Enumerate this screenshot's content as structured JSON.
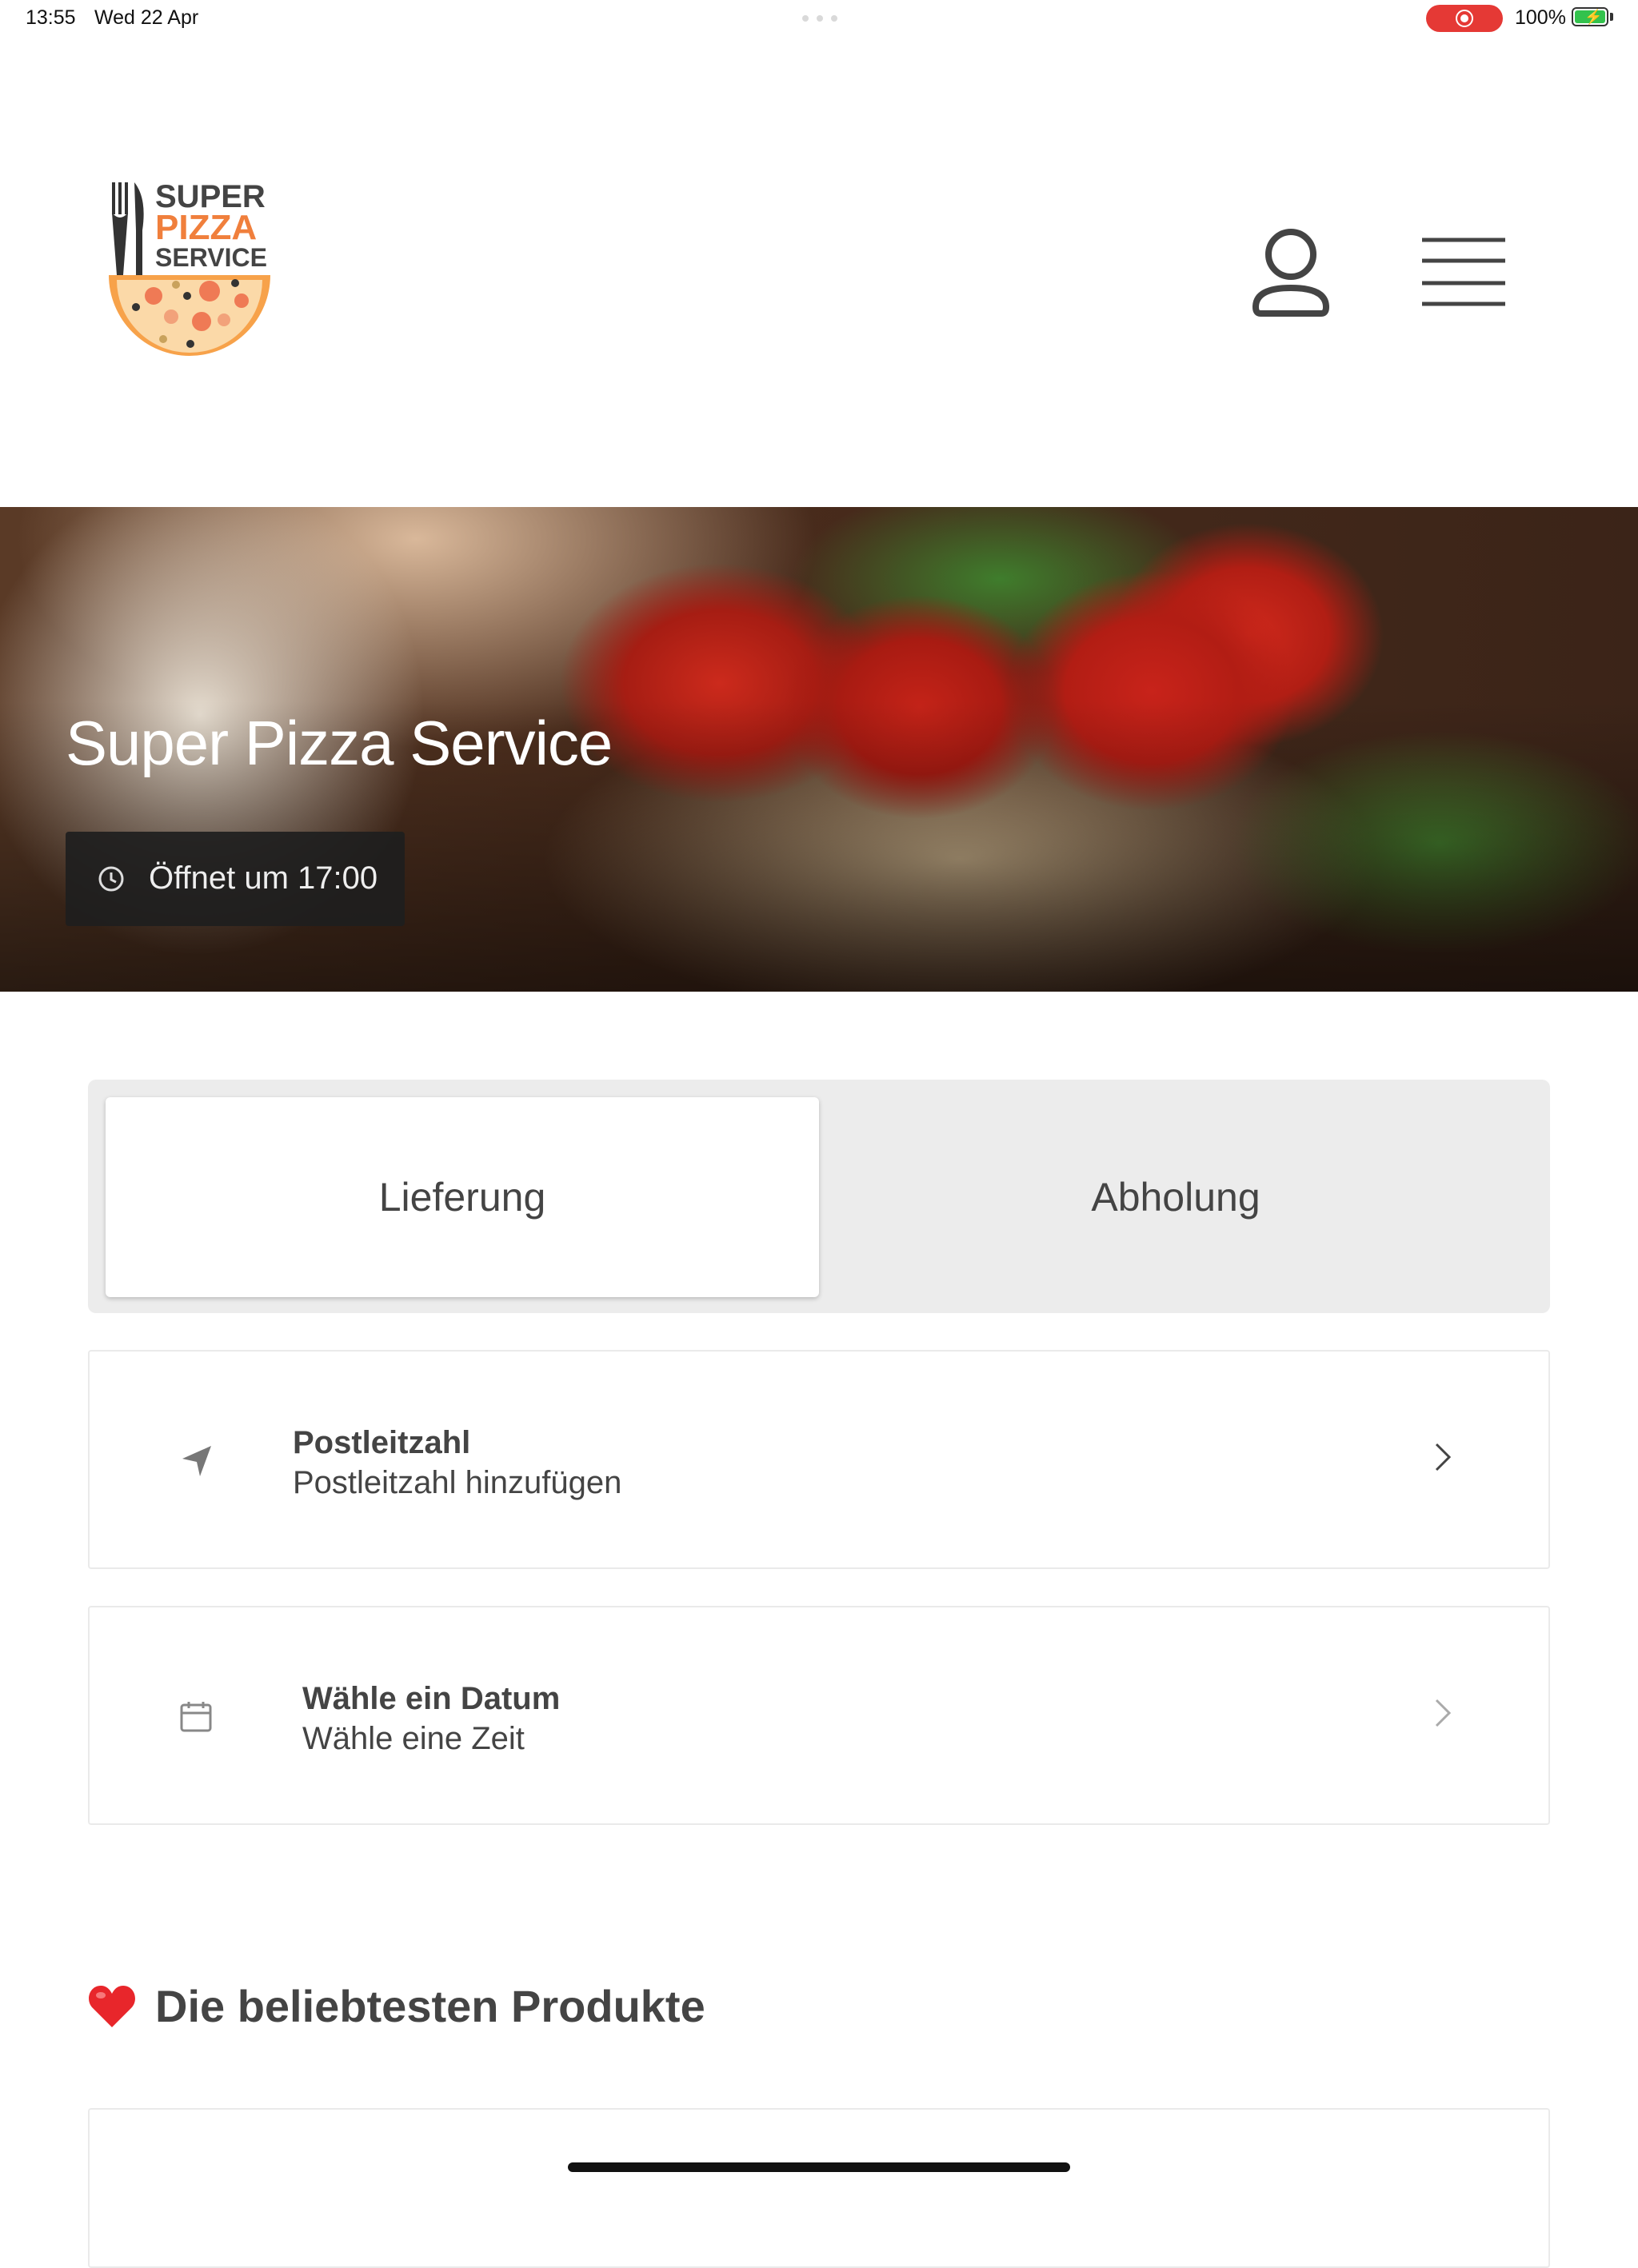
{
  "status_bar": {
    "time": "13:55",
    "date": "Wed 22 Apr",
    "battery_percent": "100%",
    "battery_level": 1.0,
    "recording_color": "#e53935"
  },
  "header": {
    "logo": {
      "line1": "SUPER",
      "line2": "PIZZA",
      "line3": "SERVICE",
      "accent_color": "#f07f3c"
    },
    "icons": [
      "user-icon",
      "hamburger-menu-icon"
    ]
  },
  "hero": {
    "title": "Super Pizza Service",
    "opening_text": "Öffnet um 17:00"
  },
  "order_type": {
    "tabs": [
      {
        "label": "Lieferung",
        "selected": true
      },
      {
        "label": "Abholung",
        "selected": false
      }
    ]
  },
  "cards": {
    "postcode": {
      "title": "Postleitzahl",
      "subtitle": "Postleitzahl hinzufügen",
      "icon": "location-arrow-icon"
    },
    "date": {
      "title": "Wähle ein Datum",
      "subtitle": "Wähle eine Zeit",
      "icon": "calendar-icon"
    }
  },
  "popular": {
    "title": "Die beliebtesten Produkte",
    "icon": "heart-icon"
  },
  "colors": {
    "accent": "#f07f3c",
    "toggle_bg": "#ececec",
    "text": "#444444"
  }
}
